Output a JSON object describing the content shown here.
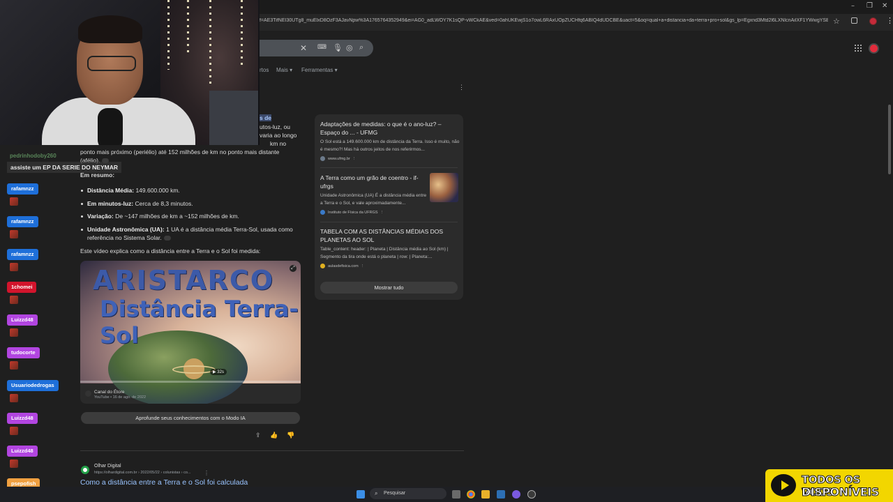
{
  "browser": {
    "url": "f=AE3TifNEI30UTg8_muElxD8OzF3AJavNpw%3A1765764352949&ei=AG0_adLWOY7K1sQP-vWCkAE&ved=0ahUKEwjS1o7owL6RAxUOpZUCHfq6ABIQ4dUDCBE&uact=5&oq=qual+a+distancia+da+terra+pro+sol&gs_lp=Egxnd3Mtd2l6LXNlcnAiIXF1YWwgYSBkaXN..."
  },
  "search_tabs": {
    "partial": "rtos",
    "more": "Mais",
    "tools": "Ferramentas"
  },
  "chat": {
    "top_name": "pedrinhodoby260",
    "top_message": "assiste um EP DA SERIE DO NEYMAR",
    "users": [
      {
        "name": "rafamnzz",
        "color": "#1e6fd9"
      },
      {
        "name": "rafamnzz",
        "color": "#1e6fd9"
      },
      {
        "name": "rafamnzz",
        "color": "#1e6fd9"
      },
      {
        "name": "1chomei",
        "color": "#d2142c"
      },
      {
        "name": "Luizzd48",
        "color": "#b245e0"
      },
      {
        "name": "tudocorte",
        "color": "#b245e0"
      },
      {
        "name": "Usuariodedrogas",
        "color": "#1e6fd9"
      },
      {
        "name": "Luizzd48",
        "color": "#b245e0"
      },
      {
        "name": "Luizzd48",
        "color": "#b245e0"
      },
      {
        "name": "psepofish",
        "color": "#f0a040"
      }
    ]
  },
  "answer": {
    "highlight": "s de",
    "snippet_lines": [
      "utos-luz, ou",
      "varia ao longo",
      "km no",
      "ponto mais próximo (periélio) até 152 milhões de km no ponto mais distante",
      "(afélio)."
    ],
    "summary_label": "Em resumo:",
    "bullets": [
      {
        "term": "Distância Média:",
        "text": " 149.600.000 km."
      },
      {
        "term": "Em minutos-luz:",
        "text": " Cerca de 8,3 minutos."
      },
      {
        "term": "Variação:",
        "text": " De ~147 milhões de km a ~152 milhões de km."
      },
      {
        "term": "Unidade Astronômica (UA):",
        "text": " 1 UA é a distância média Terra-Sol, usada como referência no Sistema Solar."
      }
    ],
    "video_intro": "Este vídeo explica como a distância entre a Terra e o Sol foi medida:",
    "video": {
      "title_line1": "ARISTARCO",
      "title_line2": "Distância Terra-Sol",
      "duration": "32s",
      "channel": "Canal do Étore",
      "meta": "YouTube • 16 de ago. de 2022"
    },
    "ai_mode_button": "Aprofunde seus conhecimentos com o Modo IA"
  },
  "result": {
    "site_name": "Olhar Digital",
    "site_url": "https://olhardigital.com.br › 2022/05/22 › colunistas › co...",
    "title": "Como a distância entre a Terra e o Sol foi calculada"
  },
  "side_panel": {
    "items": [
      {
        "title": "Adaptações de medidas: o que é o ano-luz? – Espaço do ... - UFMG",
        "desc": "O Sol está a 149.600.000 km de distância da Terra. Isso é muito, não é mesmo?! Mas há outros jeitos de nos referirmos...",
        "source": "www.ufmg.br"
      },
      {
        "title": "A Terra como um grão de coentro - if-ufrgs",
        "desc": "Unidade Astronômica (UA) É a distância média entre a Terra e o Sol, e vale aproximadamente...",
        "source": "Instituto de Física da UFRGS"
      },
      {
        "title": "TABELA COM AS DISTÂNCIAS MÉDIAS DOS PLANETAS AO SOL",
        "desc": "Table_content: header: | Planeta | Distância média ao Sol (km) | Segmento da tira onde está o planeta | row: | Planeta:...",
        "source": "aulasdefisica.com"
      }
    ],
    "show_all": "Mostrar tudo"
  },
  "taskbar": {
    "search_label": "Pesquisar"
  },
  "vod_banner": {
    "line1": "TODOS OS VODS",
    "line2": "DISPONÍVEIS"
  }
}
